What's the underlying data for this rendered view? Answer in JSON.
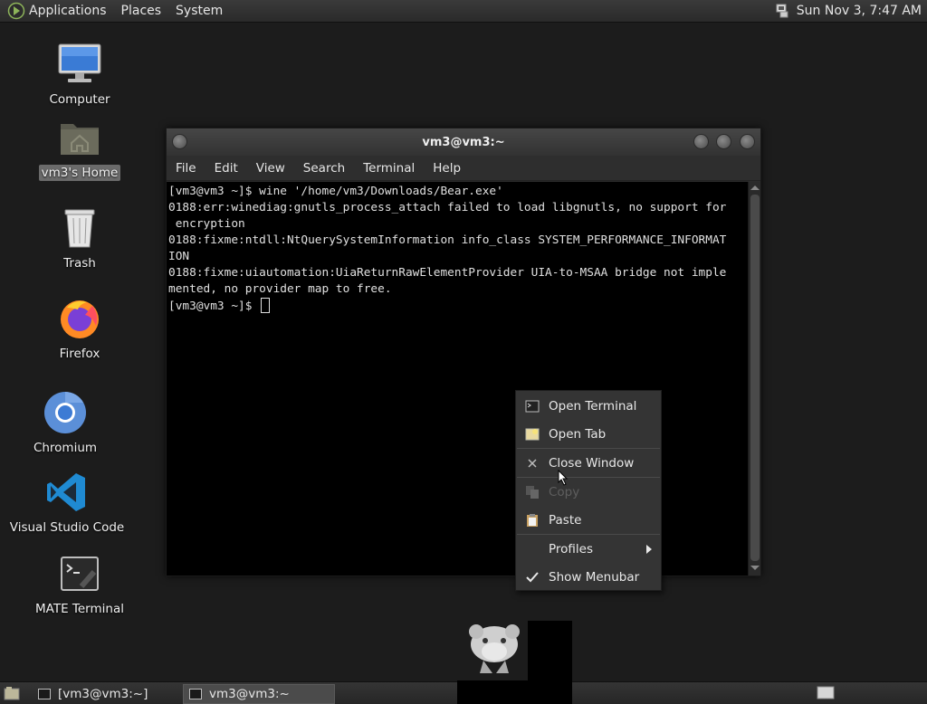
{
  "top_panel": {
    "menus": [
      "Applications",
      "Places",
      "System"
    ],
    "clock": "Sun Nov 3,  7:47 AM"
  },
  "desktop": {
    "icons": [
      {
        "label": "Computer",
        "icon": "computer-icon"
      },
      {
        "label": "vm3's Home",
        "icon": "home-folder-icon",
        "selected": true
      },
      {
        "label": "Trash",
        "icon": "trash-icon"
      },
      {
        "label": "Firefox",
        "icon": "firefox-icon"
      },
      {
        "label": "Chromium",
        "icon": "chromium-icon"
      },
      {
        "label": "Visual Studio Code",
        "icon": "vscode-icon"
      },
      {
        "label": "MATE Terminal",
        "icon": "terminal-icon"
      }
    ]
  },
  "terminal": {
    "title": "vm3@vm3:~",
    "menus": [
      "File",
      "Edit",
      "View",
      "Search",
      "Terminal",
      "Help"
    ],
    "lines": [
      "[vm3@vm3 ~]$ wine '/home/vm3/Downloads/Bear.exe'",
      "0188:err:winediag:gnutls_process_attach failed to load libgnutls, no support for",
      " encryption",
      "0188:fixme:ntdll:NtQuerySystemInformation info_class SYSTEM_PERFORMANCE_INFORMAT",
      "ION",
      "0188:fixme:uiautomation:UiaReturnRawElementProvider UIA-to-MSAA bridge not imple",
      "mented, no provider map to free."
    ],
    "prompt": "[vm3@vm3 ~]$ "
  },
  "context_menu": {
    "items": [
      {
        "label": "Open Terminal",
        "icon": "terminal-icon"
      },
      {
        "label": "Open Tab",
        "icon": "new-tab-icon"
      },
      {
        "label": "Close Window",
        "icon": "close-icon"
      },
      {
        "label": "Copy",
        "icon": "copy-icon",
        "disabled": true
      },
      {
        "label": "Paste",
        "icon": "paste-icon"
      },
      {
        "label": "Profiles",
        "icon": "",
        "submenu": true
      },
      {
        "label": "Show Menubar",
        "icon": "checkmark-icon",
        "checked": true
      }
    ]
  },
  "taskbar": {
    "tasks": [
      {
        "label": "[vm3@vm3:~]",
        "active": false
      },
      {
        "label": "vm3@vm3:~",
        "active": true
      }
    ]
  },
  "colors": {
    "desktop_bg": "#1c1c1c",
    "terminal_bg": "#000000",
    "menu_bg": "#343434",
    "selected_label_bg": "#6b6b6b"
  }
}
